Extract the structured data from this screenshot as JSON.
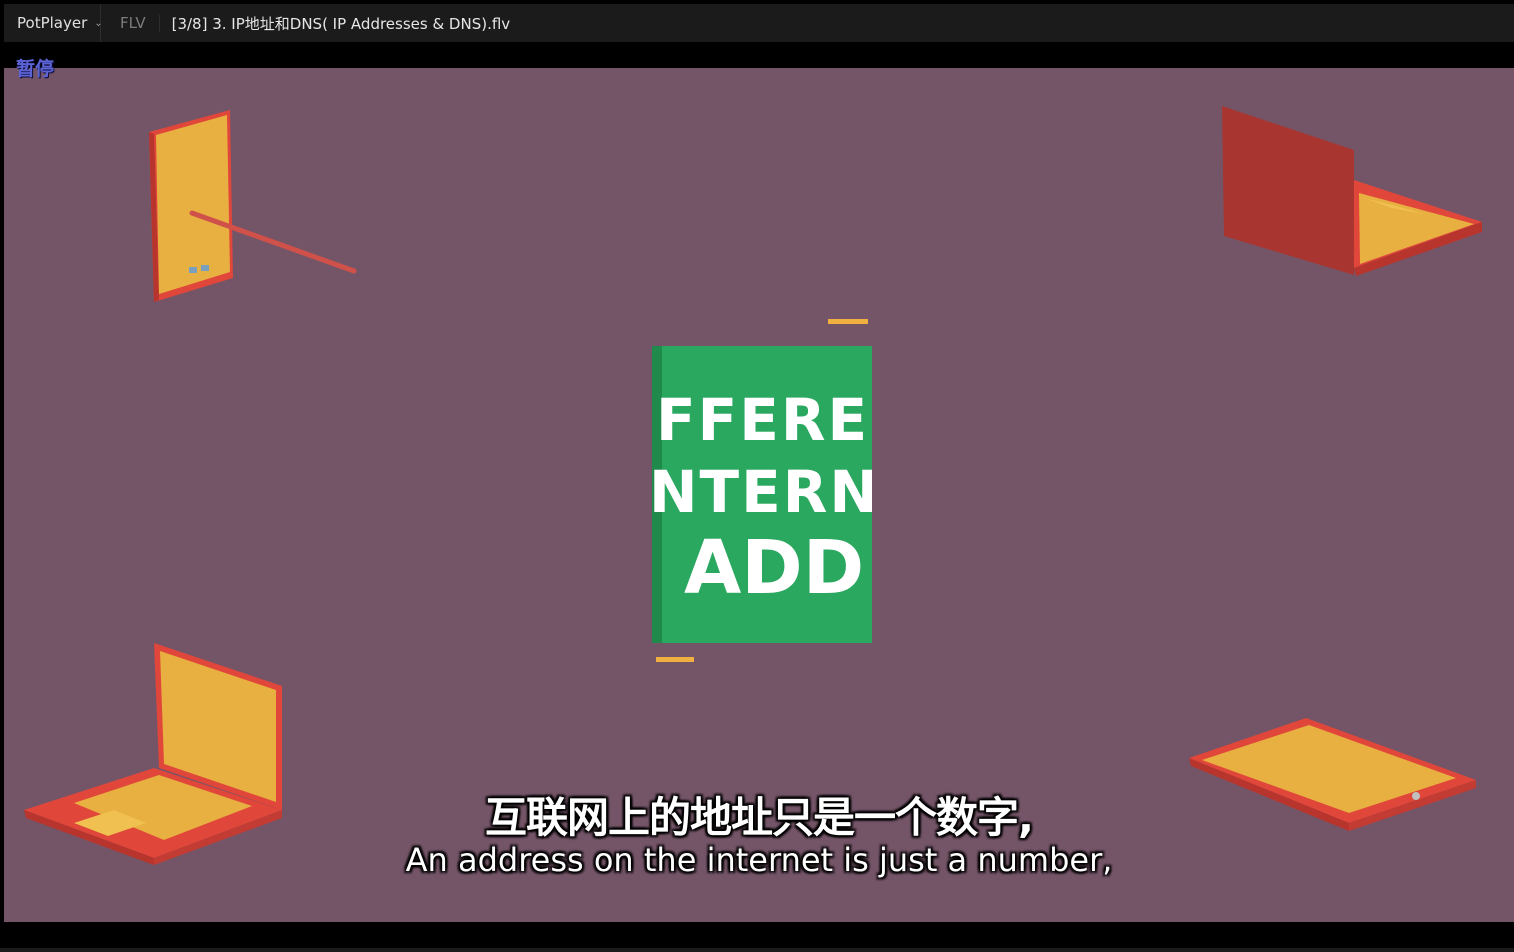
{
  "player": {
    "app_name": "PotPlayer",
    "format": "FLV",
    "file_title": "[3/8] 3. IP地址和DNS( IP Addresses & DNS).flv",
    "osd_status": "暂停"
  },
  "video_frame": {
    "background_color": "#745568",
    "sign_lines": [
      "FFEREN",
      "NTERN",
      "ADD"
    ],
    "sign_color": "#2aa860",
    "devices": [
      "phone-icon",
      "laptop-icon",
      "laptop-icon",
      "tablet-icon"
    ]
  },
  "subtitles": {
    "chinese": "互联网上的地址只是一个数字,",
    "english": "An address on the internet is just a number,"
  }
}
